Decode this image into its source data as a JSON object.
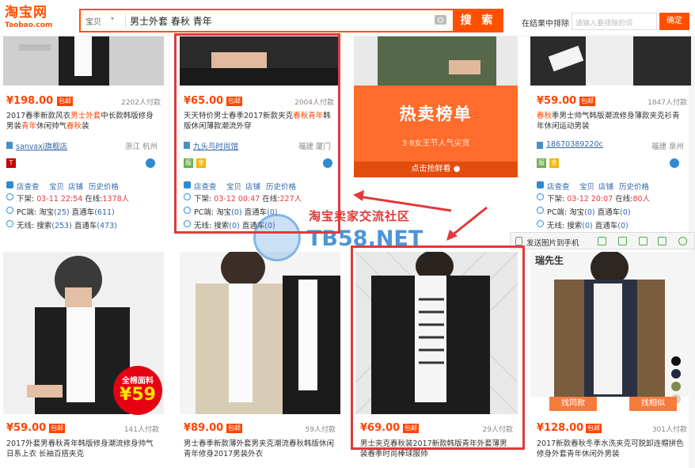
{
  "header": {
    "logo_cn": "淘宝网",
    "logo_en": "Taobao.com",
    "search_type": "宝贝",
    "search_query": "男士外套 春秋 青年",
    "search_button": "搜 索",
    "in_results_label": "在结果中排除",
    "in_results_placeholder": "请输入要排除的词",
    "ok_button": "确定"
  },
  "colors": {
    "brand": "#ff5000",
    "price": "#ff4400",
    "highlight_box": "#e03a3a",
    "link": "#3366aa"
  },
  "row1": [
    {
      "price": "¥198.00",
      "freeship": "包邮",
      "paid": "2202人付款",
      "title_a": "2017春季新款风衣",
      "title_hl1": "男士外套",
      "title_b": "中长款韩版修身男装",
      "title_hl2": "青年",
      "title_c": "休闲帅气",
      "title_hl3": "春秋",
      "title_d": "装",
      "shop": "sanvaxi旗舰店",
      "location": "浙江 杭州",
      "tools": [
        "店查查",
        "宝贝",
        "店铺",
        "历史价格"
      ],
      "stat1_label": "下架:",
      "stat1_time": "03-11 22:54",
      "stat1_online_label": "在线:",
      "stat1_online": "1378人",
      "stat2_label": "PC端:",
      "stat2_a": "淘宝",
      "stat2_a_val": "(25)",
      "stat2_b": "直通车",
      "stat2_b_val": "(611)",
      "stat3_label": "无线:",
      "stat3_a": "搜索",
      "stat3_a_val": "(253)",
      "stat3_b": "直通车",
      "stat3_b_val": "(473)"
    },
    {
      "price": "¥65.00",
      "freeship": "包邮",
      "paid": "2004人付款",
      "title_a": "天天特价男士春季2017新款夹克",
      "title_hl1": "春秋",
      "title_b": "",
      "title_hl2": "青年",
      "title_c": "韩版休闲薄款潮流外穿",
      "title_hl3": "",
      "title_d": "",
      "shop": "九头鸟时尚馆",
      "location": "福建 厦门",
      "tools": [
        "店查查",
        "宝贝",
        "店铺",
        "历史价格"
      ],
      "stat1_label": "下架:",
      "stat1_time": "03-12 00:47",
      "stat1_online_label": "在线:",
      "stat1_online": "227人",
      "stat2_label": "PC端:",
      "stat2_a": "淘宝",
      "stat2_a_val": "(0)",
      "stat2_b": "直通车",
      "stat2_b_val": "(0)",
      "stat3_label": "无线:",
      "stat3_a": "搜索",
      "stat3_a_val": "(0)",
      "stat3_b": "直通车",
      "stat3_b_val": "(0)"
    },
    {
      "price": "¥59.00",
      "freeship": "包邮",
      "paid": "1847人付款",
      "title_a": "",
      "title_hl1": "春秋",
      "title_b": "季男士帅气韩版潮流修身薄款夹克衫青年休闲运动男装",
      "title_hl2": "",
      "title_c": "",
      "title_hl3": "",
      "title_d": "",
      "shop": "18670389220c",
      "location": "福建 泉州",
      "tools": [
        "店查查",
        "宝贝",
        "店铺",
        "历史价格"
      ],
      "stat1_label": "下架:",
      "stat1_time": "03-12 20:07",
      "stat1_online_label": "在线:",
      "stat1_online": "80人",
      "stat2_label": "PC端:",
      "stat2_a": "淘宝",
      "stat2_a_val": "(0)",
      "stat2_b": "直通车",
      "stat2_b_val": "(0)",
      "stat3_label": "无线:",
      "stat3_a": "搜索",
      "stat3_a_val": "(0)",
      "stat3_b": "直通车",
      "stat3_b_val": "(0)"
    }
  ],
  "hot_banner": {
    "title": "热卖榜单",
    "subtitle": "3·8女王节人气尖货",
    "cta": "点击抢鲜看"
  },
  "watermark": {
    "cn": "淘宝卖家交流社区",
    "en": "TB58.NET"
  },
  "floatbar": {
    "send_label": "发送图片到手机"
  },
  "row2": [
    {
      "price": "¥59.00",
      "freeship": "包邮",
      "paid": "141人付款",
      "title": "2017外套男春秋青年韩版修身潮流修身帅气日系上衣 长袖百搭夹克",
      "promo_line1": "全棉面料",
      "promo_line2": "¥59"
    },
    {
      "price": "¥89.00",
      "freeship": "包邮",
      "paid": "59人付款",
      "title": "男士春季新款薄外套男夹克潮流春秋韩版休闲青年修身2017男装外衣"
    },
    {
      "price": "¥69.00",
      "freeship": "包邮",
      "paid": "29人付款",
      "title": "男士夹克春秋装2017新款韩版青年外套薄男装春季时尚棒球服帅"
    },
    {
      "price": "¥128.00",
      "freeship": "包邮",
      "paid": "301人付款",
      "title": "2017新款春秋冬季水洗夹克可脱卸连帽拼色修身外套青年休闲外男装",
      "brand_label": "瑞先生",
      "btn_similar_style": "找同款",
      "btn_similar": "找相似"
    }
  ]
}
